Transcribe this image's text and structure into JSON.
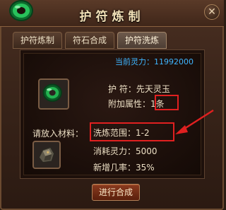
{
  "window": {
    "title": "护符炼制",
    "close_label": "✕"
  },
  "tabs": [
    {
      "label": "护符炼制",
      "active": false
    },
    {
      "label": "符石合成",
      "active": false
    },
    {
      "label": "护符洗炼",
      "active": true
    }
  ],
  "panel": {
    "current_power_label": "当前灵力：",
    "current_power_value": "11992000",
    "amulet_label": "护  符：",
    "amulet_value": "先天灵玉",
    "extra_attr_label": "附加属性：",
    "extra_attr_value": "1条",
    "material_label": "请放入材料：",
    "refine_range_label": "洗炼范围：",
    "refine_range_value": "1-2",
    "cost_label": "消耗灵力：",
    "cost_value": "5000",
    "new_rate_label": "新增几率：",
    "new_rate_value": "35%"
  },
  "actions": {
    "confirm_label": "进行合成"
  },
  "colors": {
    "accent_blue": "#3fb5ff",
    "highlight_red": "#e02020",
    "jade_green": "#1fa84a"
  },
  "icons": {
    "logo": "jade-ring-icon",
    "amulet": "jade-ring-icon",
    "material": "ore-stone-icon"
  }
}
